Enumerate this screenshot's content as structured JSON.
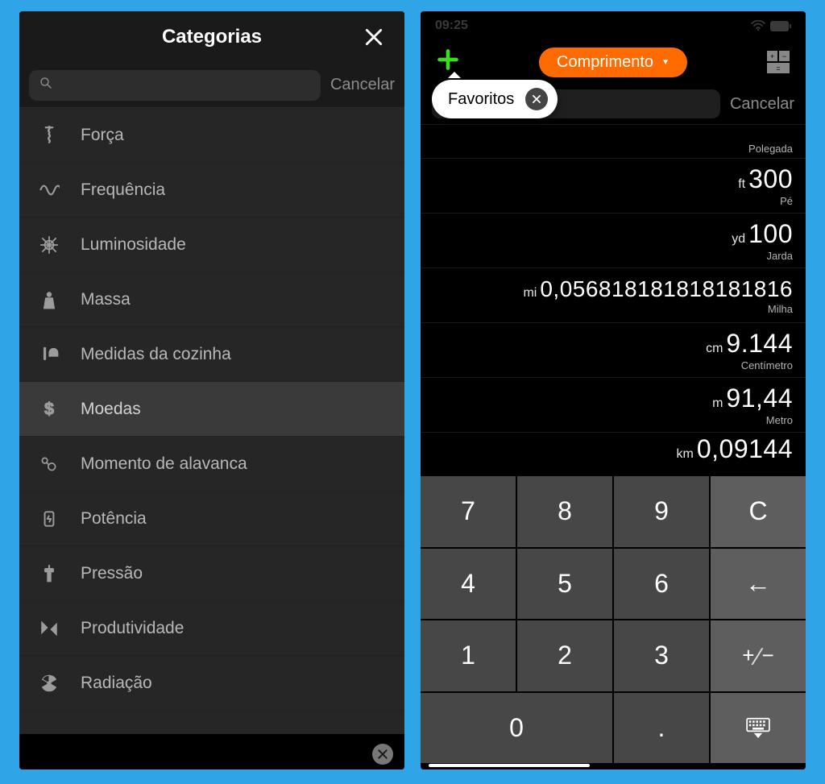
{
  "left": {
    "title": "Categorias",
    "cancel": "Cancelar",
    "items": [
      {
        "key": "forca",
        "label": "Força",
        "highlight": false
      },
      {
        "key": "frequencia",
        "label": "Frequência",
        "highlight": false
      },
      {
        "key": "luminosidade",
        "label": "Luminosidade",
        "highlight": false
      },
      {
        "key": "massa",
        "label": "Massa",
        "highlight": false
      },
      {
        "key": "cozinha",
        "label": "Medidas da cozinha",
        "highlight": false
      },
      {
        "key": "moedas",
        "label": "Moedas",
        "highlight": true
      },
      {
        "key": "momento",
        "label": "Momento de alavanca",
        "highlight": false
      },
      {
        "key": "potencia",
        "label": "Potência",
        "highlight": false
      },
      {
        "key": "pressao",
        "label": "Pressão",
        "highlight": false
      },
      {
        "key": "produtividade",
        "label": "Produtividade",
        "highlight": false
      },
      {
        "key": "radiacao",
        "label": "Radiação",
        "highlight": false
      }
    ]
  },
  "right": {
    "status_time": "09:25",
    "category_button": "Comprimento",
    "tooltip": "Favoritos",
    "cancel": "Cancelar",
    "rows": [
      {
        "abbr": "",
        "value": "",
        "unit": "Polegada",
        "cls": "first"
      },
      {
        "abbr": "ft",
        "value": "300",
        "unit": "Pé",
        "cls": ""
      },
      {
        "abbr": "yd",
        "value": "100",
        "unit": "Jarda",
        "cls": ""
      },
      {
        "abbr": "mi",
        "value": "0,056818181818181816",
        "unit": "Milha",
        "cls": "mi"
      },
      {
        "abbr": "cm",
        "value": "9.144",
        "unit": "Centímetro",
        "cls": ""
      },
      {
        "abbr": "m",
        "value": "91,44",
        "unit": "Metro",
        "cls": ""
      },
      {
        "abbr": "km",
        "value": "0,09144",
        "unit": "",
        "cls": "last"
      }
    ],
    "keys": [
      {
        "label": "7",
        "type": "num",
        "name": "key-7"
      },
      {
        "label": "8",
        "type": "num",
        "name": "key-8"
      },
      {
        "label": "9",
        "type": "num",
        "name": "key-9"
      },
      {
        "label": "C",
        "type": "func",
        "name": "key-clear"
      },
      {
        "label": "4",
        "type": "num",
        "name": "key-4"
      },
      {
        "label": "5",
        "type": "num",
        "name": "key-5"
      },
      {
        "label": "6",
        "type": "num",
        "name": "key-6"
      },
      {
        "label": "←",
        "type": "func",
        "name": "key-backspace"
      },
      {
        "label": "1",
        "type": "num",
        "name": "key-1"
      },
      {
        "label": "2",
        "type": "num",
        "name": "key-2"
      },
      {
        "label": "3",
        "type": "num",
        "name": "key-3"
      },
      {
        "label": "±",
        "type": "func",
        "name": "key-plusminus"
      },
      {
        "label": "0",
        "type": "num",
        "name": "key-0",
        "wide": true
      },
      {
        "label": ".",
        "type": "num",
        "name": "key-decimal"
      },
      {
        "label": "kb",
        "type": "func",
        "name": "key-keyboard"
      }
    ]
  }
}
